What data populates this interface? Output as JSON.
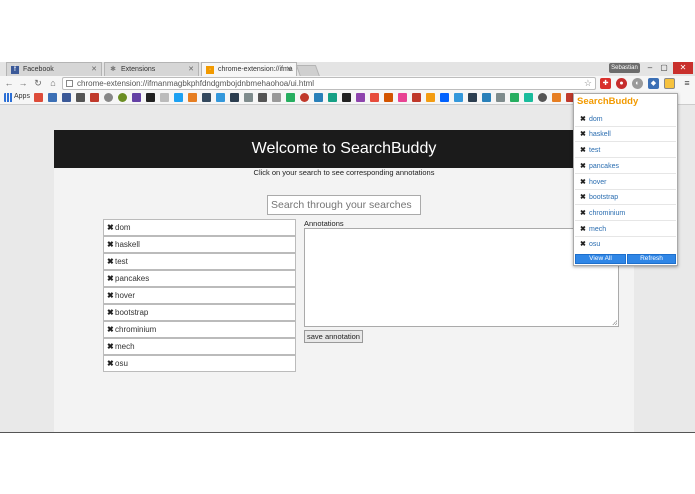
{
  "browser": {
    "tabs": [
      {
        "label": "Facebook",
        "icon": "facebook-icon",
        "active": false
      },
      {
        "label": "Extensions",
        "icon": "puzzle-icon",
        "active": false
      },
      {
        "label": "chrome-extension://ifma",
        "icon": "extension-icon",
        "active": true
      }
    ],
    "user": "Sebastian",
    "window_buttons": [
      "–",
      "▢",
      "✕"
    ],
    "url": "chrome-extension://ifmanmagbkphfdndgmbojdnbmehaohoa/ui.html",
    "apps_label": "Apps"
  },
  "page": {
    "title": "Welcome to SearchBuddy",
    "subtitle": "Click on your search to see corresponding annotations",
    "search_placeholder": "Search through your searches",
    "searches": [
      "dom",
      "haskell",
      "test",
      "pancakes",
      "hover",
      "bootstrap",
      "chrominium",
      "mech",
      "osu"
    ],
    "annotations_label": "Annotations",
    "save_button": "save annotation"
  },
  "popup": {
    "title": "SearchBuddy",
    "items": [
      "dom",
      "haskell",
      "test",
      "pancakes",
      "hover",
      "bootstrap",
      "chrominium",
      "mech",
      "osu"
    ],
    "view_all": "View All",
    "refresh": "Refresh"
  },
  "colors": {
    "header_bg": "#1b1b1b",
    "popup_title": "#f29a00",
    "popup_link": "#2a6db0",
    "popup_button": "#2f86e6"
  }
}
